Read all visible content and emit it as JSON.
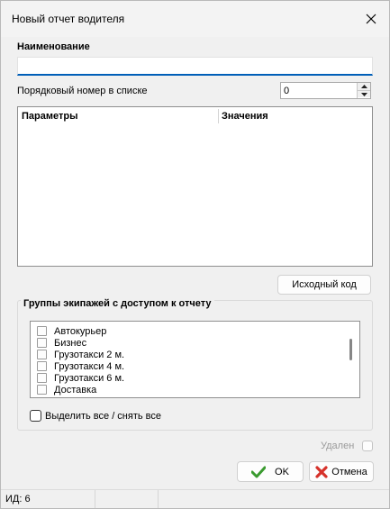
{
  "window": {
    "title": "Новый отчет водителя"
  },
  "form": {
    "name_label": "Наименование",
    "name_value": "",
    "order_label": "Порядковый номер в списке",
    "order_value": "0"
  },
  "params_table": {
    "columns": [
      "Параметры",
      "Значения"
    ]
  },
  "source_button": "Исходный код",
  "groups": {
    "legend": "Группы экипажей с доступом к отчету",
    "items": [
      {
        "label": "Автокурьер",
        "checked": false
      },
      {
        "label": "Бизнес",
        "checked": false
      },
      {
        "label": "Грузотакси 2 м.",
        "checked": false
      },
      {
        "label": "Грузотакси 4 м.",
        "checked": false
      },
      {
        "label": "Грузотакси 6 м.",
        "checked": false
      },
      {
        "label": "Доставка",
        "checked": false
      }
    ],
    "select_all_label": "Выделить все / снять все"
  },
  "deleted_label": "Удален",
  "buttons": {
    "ok": "OK",
    "cancel": "Отмена"
  },
  "status": {
    "id_text": "ИД: 6"
  },
  "colors": {
    "accent": "#005fb8",
    "ok_icon": "#3a9a2f",
    "cancel_icon": "#d6312a"
  },
  "icons": {
    "close": "close-icon",
    "ok": "check-icon",
    "cancel": "cross-icon"
  }
}
